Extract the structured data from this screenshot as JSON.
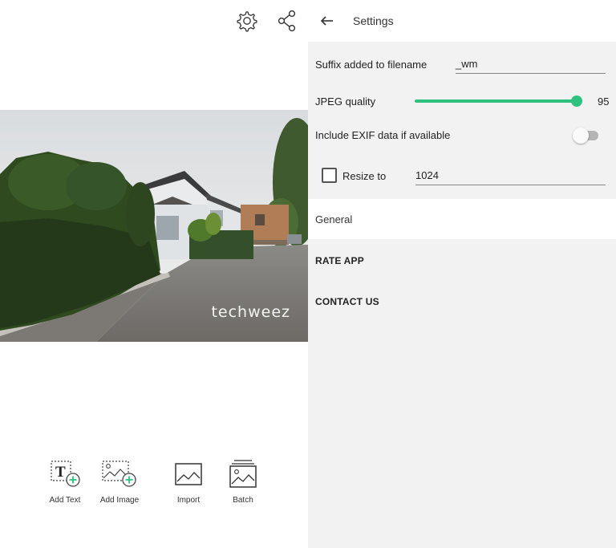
{
  "editor": {
    "top_icons": {
      "settings_icon": "gear-icon",
      "share_icon": "share-icon"
    },
    "watermark_text": "techweez",
    "tools": [
      {
        "label": "Add Text",
        "icon": "add-text-icon"
      },
      {
        "label": "Add Image",
        "icon": "add-image-icon"
      },
      {
        "label": "Import",
        "icon": "import-icon"
      },
      {
        "label": "Batch",
        "icon": "batch-icon"
      }
    ]
  },
  "settings": {
    "title": "Settings",
    "back_icon": "arrow-left-icon",
    "suffix": {
      "label": "Suffix added to filename",
      "value": "_wm"
    },
    "jpeg_quality": {
      "label": "JPEG quality",
      "value": "95",
      "fraction": 0.95
    },
    "exif": {
      "label": "Include EXIF data if available",
      "enabled": false
    },
    "resize": {
      "label": "Resize to",
      "value": "1024",
      "checked": false
    },
    "section_general": "General",
    "links": {
      "rate_app": "RATE APP",
      "contact_us": "CONTACT US"
    },
    "accent_color": "#2ec27e"
  }
}
